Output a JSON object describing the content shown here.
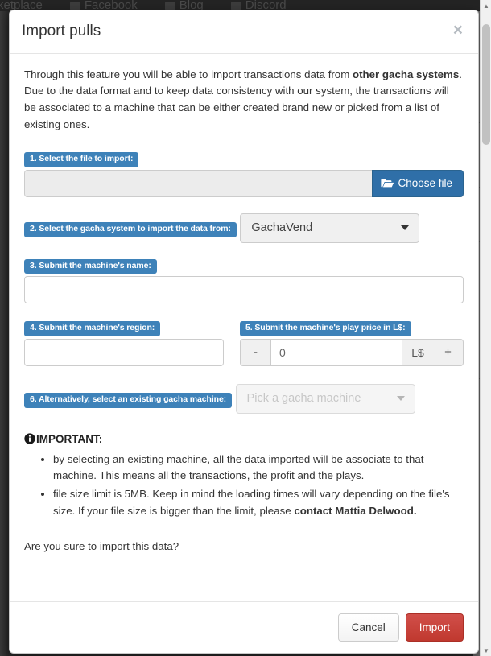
{
  "background": {
    "nav_items": [
      {
        "label": "rketplace",
        "icon": "marketplace-icon"
      },
      {
        "label": "Facebook",
        "icon": "facebook-icon"
      },
      {
        "label": "Blog",
        "icon": "blog-icon"
      },
      {
        "label": "Discord",
        "icon": "discord-icon"
      }
    ]
  },
  "modal": {
    "title": "Import pulls",
    "close_label": "×",
    "intro": {
      "part1": "Through this feature you will be able to import transactions data from ",
      "bold1": "other gacha systems",
      "part2": ". Due to the data format and to keep data consistency with our system, the transactions will be associated to a machine that can be either created brand new or picked from a list of existing ones."
    },
    "steps": {
      "file": {
        "label": "1. Select the file to import:",
        "value": "",
        "placeholder": "",
        "button_label": "Choose file",
        "button_icon": "folder-open-icon"
      },
      "system": {
        "label": "2. Select the gacha system to import the data from:",
        "selected": "GachaVend",
        "options": [
          "GachaVend"
        ],
        "caret_icon": "chevron-down-icon"
      },
      "name": {
        "label": "3. Submit the machine's name:",
        "value": "",
        "placeholder": ""
      },
      "region": {
        "label": "4. Submit the machine's region:",
        "value": "",
        "placeholder": ""
      },
      "price": {
        "label": "5. Submit the machine's play price in L$:",
        "value": "0",
        "decrement_label": "-",
        "increment_label": "+",
        "currency_label": "L$"
      },
      "existing": {
        "label": "6. Alternatively, select an existing gacha machine:",
        "selected": "Pick a gacha machine",
        "options": [
          "Pick a gacha machine"
        ],
        "caret_icon": "chevron-down-icon",
        "disabled": true
      }
    },
    "important": {
      "icon": "info-circle-icon",
      "heading": "IMPORTANT:",
      "notes": [
        {
          "text": "by selecting an existing machine, all the data imported will be associate to that machine. This means all the transactions, the profit and the plays.",
          "bold": ""
        },
        {
          "text": "file size limit is 5MB. Keep in mind the loading times will vary depending on the file's size. If your file size is bigger than the limit, please ",
          "bold": "contact Mattia Delwood."
        }
      ]
    },
    "confirm_text": "Are you sure to import this data?",
    "footer": {
      "cancel_label": "Cancel",
      "import_label": "Import"
    }
  },
  "colors": {
    "step_badge": "#3e82b9",
    "choose_file_button": "#2f6fa8",
    "import_button": "#c0392f",
    "modal_background": "#ffffff",
    "page_background": "#2b2b2b"
  }
}
